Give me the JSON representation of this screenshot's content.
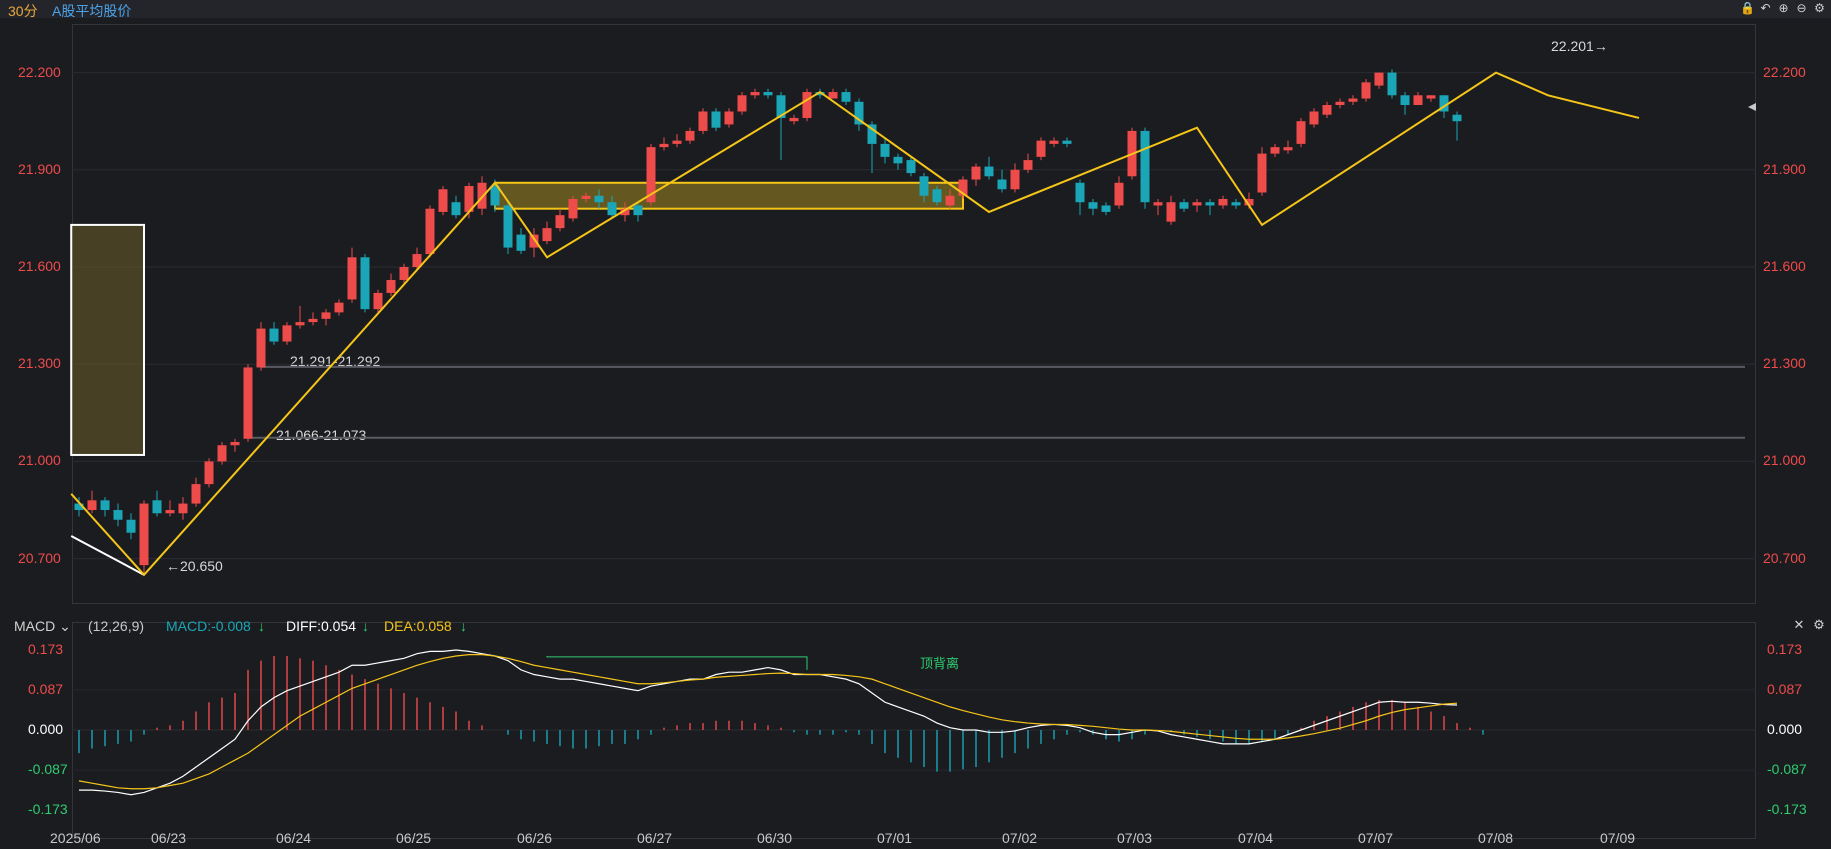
{
  "header": {
    "period": "30分",
    "title": "A股平均股价",
    "tools": [
      {
        "name": "lock-icon",
        "glyph": "🔒"
      },
      {
        "name": "undo-icon",
        "glyph": "↶"
      },
      {
        "name": "zoom-in-icon",
        "glyph": "⊕"
      },
      {
        "name": "zoom-out-icon",
        "glyph": "⊖"
      },
      {
        "name": "gear-icon",
        "glyph": "⚙"
      }
    ]
  },
  "main_axis": {
    "left_ticks": [
      "22.200",
      "21.900",
      "21.600",
      "21.300",
      "21.000",
      "20.700"
    ],
    "right_ticks": [
      "22.200",
      "21.900",
      "21.600",
      "21.300",
      "21.000",
      "20.700"
    ],
    "tick_color": "#ee4b4b"
  },
  "annotations": {
    "low": "←20.650",
    "high": "22.201→",
    "level1": "21.291-21.292",
    "level2": "21.066-21.073"
  },
  "macd": {
    "indicator": "MACD",
    "params": "(12,26,9)",
    "macd_label": "MACD:-0.008",
    "diff_label": "DIFF:0.054",
    "dea_label": "DEA:0.058",
    "divergence": "顶背离",
    "ticks": [
      "0.173",
      "0.087",
      "0.000",
      "-0.087",
      "-0.173"
    ],
    "tick_colors": [
      "#ee4b4b",
      "#ee4b4b",
      "#ffffff",
      "#2ecc71",
      "#2ecc71"
    ],
    "colors": {
      "up": "#ee4b4b",
      "down": "#1aa6b7",
      "diff": "#ffffff",
      "dea": "#f5c518",
      "macd_label": "#1aa6b7",
      "dea_label": "#f5c518"
    }
  },
  "x_labels": [
    "2025/06",
    "06/23",
    "06/24",
    "06/25",
    "06/26",
    "06/27",
    "06/30",
    "07/01",
    "07/02",
    "07/03",
    "07/04",
    "07/07",
    "07/08",
    "07/09"
  ],
  "colors": {
    "up": "#ee4b4b",
    "down": "#1aa6b7",
    "zigzag": "#f5c518",
    "background": "#1b1c20"
  },
  "chart_data": {
    "type": "candlestick",
    "ylim": [
      20.56,
      22.35
    ],
    "candles": [
      [
        20.87,
        20.85,
        20.89,
        20.83
      ],
      [
        20.85,
        20.88,
        20.91,
        20.84
      ],
      [
        20.88,
        20.85,
        20.89,
        20.83
      ],
      [
        20.85,
        20.82,
        20.87,
        20.8
      ],
      [
        20.82,
        20.78,
        20.84,
        20.76
      ],
      [
        20.68,
        20.87,
        20.88,
        20.65
      ],
      [
        20.88,
        20.84,
        20.91,
        20.83
      ],
      [
        20.84,
        20.85,
        20.88,
        20.83
      ],
      [
        20.84,
        20.87,
        20.89,
        20.82
      ],
      [
        20.87,
        20.93,
        20.95,
        20.86
      ],
      [
        20.93,
        21.0,
        21.01,
        20.92
      ],
      [
        21.0,
        21.05,
        21.06,
        20.99
      ],
      [
        21.05,
        21.06,
        21.07,
        21.03
      ],
      [
        21.07,
        21.29,
        21.3,
        21.06
      ],
      [
        21.29,
        21.41,
        21.43,
        21.28
      ],
      [
        21.41,
        21.37,
        21.43,
        21.36
      ],
      [
        21.37,
        21.42,
        21.43,
        21.36
      ],
      [
        21.42,
        21.43,
        21.48,
        21.41
      ],
      [
        21.43,
        21.44,
        21.46,
        21.42
      ],
      [
        21.44,
        21.46,
        21.47,
        21.42
      ],
      [
        21.46,
        21.49,
        21.5,
        21.45
      ],
      [
        21.5,
        21.63,
        21.66,
        21.49
      ],
      [
        21.63,
        21.47,
        21.64,
        21.46
      ],
      [
        21.47,
        21.52,
        21.53,
        21.46
      ],
      [
        21.52,
        21.56,
        21.58,
        21.51
      ],
      [
        21.56,
        21.6,
        21.61,
        21.55
      ],
      [
        21.6,
        21.64,
        21.66,
        21.59
      ],
      [
        21.64,
        21.78,
        21.79,
        21.63
      ],
      [
        21.77,
        21.84,
        21.85,
        21.76
      ],
      [
        21.8,
        21.76,
        21.82,
        21.75
      ],
      [
        21.77,
        21.85,
        21.86,
        21.75
      ],
      [
        21.78,
        21.86,
        21.88,
        21.76
      ],
      [
        21.85,
        21.79,
        21.87,
        21.77
      ],
      [
        21.79,
        21.66,
        21.8,
        21.64
      ],
      [
        21.7,
        21.65,
        21.72,
        21.64
      ],
      [
        21.66,
        21.7,
        21.72,
        21.63
      ],
      [
        21.68,
        21.72,
        21.74,
        21.67
      ],
      [
        21.72,
        21.76,
        21.78,
        21.71
      ],
      [
        21.75,
        21.81,
        21.82,
        21.74
      ],
      [
        21.81,
        21.82,
        21.83,
        21.8
      ],
      [
        21.82,
        21.8,
        21.84,
        21.78
      ],
      [
        21.8,
        21.76,
        21.82,
        21.75
      ],
      [
        21.76,
        21.78,
        21.8,
        21.74
      ],
      [
        21.79,
        21.76,
        21.8,
        21.74
      ],
      [
        21.8,
        21.97,
        21.98,
        21.79
      ],
      [
        21.97,
        21.98,
        22.0,
        21.96
      ],
      [
        21.98,
        21.99,
        22.01,
        21.97
      ],
      [
        21.99,
        22.02,
        22.03,
        21.98
      ],
      [
        22.02,
        22.08,
        22.09,
        22.01
      ],
      [
        22.08,
        22.03,
        22.09,
        22.02
      ],
      [
        22.04,
        22.08,
        22.09,
        22.03
      ],
      [
        22.08,
        22.13,
        22.14,
        22.07
      ],
      [
        22.13,
        22.14,
        22.15,
        22.12
      ],
      [
        22.14,
        22.13,
        22.15,
        22.12
      ],
      [
        22.13,
        22.06,
        22.14,
        21.93
      ],
      [
        22.05,
        22.06,
        22.07,
        22.04
      ],
      [
        22.06,
        22.14,
        22.15,
        22.05
      ],
      [
        22.14,
        22.13,
        22.15,
        22.12
      ],
      [
        22.12,
        22.14,
        22.15,
        22.12
      ],
      [
        22.14,
        22.11,
        22.15,
        22.1
      ],
      [
        22.11,
        22.04,
        22.12,
        22.02
      ],
      [
        22.04,
        21.98,
        22.05,
        21.89
      ],
      [
        21.98,
        21.94,
        22.0,
        21.92
      ],
      [
        21.94,
        21.92,
        21.95,
        21.9
      ],
      [
        21.93,
        21.89,
        21.94,
        21.88
      ],
      [
        21.88,
        21.82,
        21.89,
        21.8
      ],
      [
        21.84,
        21.8,
        21.85,
        21.79
      ],
      [
        21.79,
        21.82,
        21.84,
        21.78
      ],
      [
        21.82,
        21.87,
        21.88,
        21.81
      ],
      [
        21.87,
        21.91,
        21.92,
        21.85
      ],
      [
        21.91,
        21.88,
        21.94,
        21.87
      ],
      [
        21.87,
        21.84,
        21.9,
        21.83
      ],
      [
        21.84,
        21.9,
        21.92,
        21.83
      ],
      [
        21.9,
        21.93,
        21.95,
        21.89
      ],
      [
        21.94,
        21.99,
        22.0,
        21.93
      ],
      [
        21.98,
        21.99,
        22.0,
        21.97
      ],
      [
        21.99,
        21.98,
        22.0,
        21.97
      ],
      [
        21.86,
        21.8,
        21.87,
        21.76
      ],
      [
        21.8,
        21.78,
        21.81,
        21.76
      ],
      [
        21.79,
        21.77,
        21.8,
        21.76
      ],
      [
        21.79,
        21.86,
        21.88,
        21.78
      ],
      [
        21.88,
        22.02,
        22.03,
        21.87
      ],
      [
        22.02,
        21.8,
        22.03,
        21.78
      ],
      [
        21.79,
        21.8,
        21.81,
        21.76
      ],
      [
        21.74,
        21.8,
        21.82,
        21.73
      ],
      [
        21.8,
        21.78,
        21.81,
        21.77
      ],
      [
        21.79,
        21.8,
        21.81,
        21.77
      ],
      [
        21.8,
        21.79,
        21.81,
        21.76
      ],
      [
        21.79,
        21.81,
        21.82,
        21.78
      ],
      [
        21.8,
        21.79,
        21.81,
        21.78
      ],
      [
        21.79,
        21.81,
        21.83,
        21.78
      ],
      [
        21.83,
        21.95,
        21.97,
        21.82
      ],
      [
        21.95,
        21.97,
        21.98,
        21.94
      ],
      [
        21.96,
        21.97,
        21.99,
        21.95
      ],
      [
        21.98,
        22.05,
        22.06,
        21.97
      ],
      [
        22.04,
        22.08,
        22.09,
        22.03
      ],
      [
        22.07,
        22.1,
        22.11,
        22.06
      ],
      [
        22.1,
        22.11,
        22.12,
        22.09
      ],
      [
        22.11,
        22.12,
        22.13,
        22.1
      ],
      [
        22.12,
        22.17,
        22.18,
        22.11
      ],
      [
        22.16,
        22.2,
        22.2,
        22.15
      ],
      [
        22.2,
        22.13,
        22.21,
        22.12
      ],
      [
        22.13,
        22.1,
        22.14,
        22.07
      ],
      [
        22.1,
        22.13,
        22.14,
        22.1
      ],
      [
        22.12,
        22.13,
        22.13,
        22.11
      ],
      [
        22.13,
        22.08,
        22.13,
        22.06
      ],
      [
        22.07,
        22.05,
        22.08,
        21.99
      ]
    ],
    "zigzag": [
      [
        -0.6,
        20.9
      ],
      [
        5,
        20.65
      ],
      [
        32,
        21.86
      ],
      [
        36,
        21.63
      ],
      [
        57,
        22.14
      ],
      [
        70,
        21.77
      ],
      [
        86,
        22.03
      ],
      [
        91,
        21.73
      ],
      [
        109,
        22.2
      ],
      [
        113,
        22.13
      ],
      [
        120,
        22.06
      ]
    ],
    "support_line": [
      [
        -0.6,
        20.77
      ],
      [
        5,
        20.65
      ]
    ],
    "boxes": [
      {
        "i1": -0.6,
        "i2": 5,
        "top": 21.73,
        "bottom": 21.02
      },
      {
        "i1": 32,
        "i2": 68,
        "top": 21.86,
        "bottom": 21.78
      }
    ],
    "levels": [
      {
        "from": 14,
        "value": 21.292
      },
      {
        "from": 13,
        "value": 21.073
      }
    ],
    "macd_hist": [
      -0.05,
      -0.04,
      -0.035,
      -0.03,
      -0.025,
      -0.01,
      0.005,
      0.01,
      0.02,
      0.04,
      0.06,
      0.07,
      0.08,
      0.13,
      0.15,
      0.16,
      0.16,
      0.155,
      0.15,
      0.14,
      0.13,
      0.12,
      0.11,
      0.1,
      0.09,
      0.08,
      0.07,
      0.06,
      0.05,
      0.04,
      0.02,
      0.01,
      0.0,
      -0.01,
      -0.02,
      -0.025,
      -0.03,
      -0.035,
      -0.04,
      -0.04,
      -0.035,
      -0.03,
      -0.03,
      -0.02,
      -0.01,
      0.005,
      0.01,
      0.015,
      0.015,
      0.02,
      0.02,
      0.02,
      0.015,
      0.01,
      0.005,
      -0.005,
      -0.01,
      -0.01,
      -0.01,
      -0.005,
      -0.01,
      -0.03,
      -0.05,
      -0.06,
      -0.07,
      -0.08,
      -0.09,
      -0.09,
      -0.085,
      -0.08,
      -0.07,
      -0.06,
      -0.05,
      -0.04,
      -0.03,
      -0.02,
      -0.01,
      -0.005,
      -0.01,
      -0.02,
      -0.025,
      -0.02,
      -0.01,
      0.0,
      -0.005,
      -0.01,
      -0.015,
      -0.02,
      -0.025,
      -0.03,
      -0.03,
      -0.025,
      -0.02,
      -0.01,
      0.005,
      0.02,
      0.03,
      0.04,
      0.05,
      0.06,
      0.065,
      0.065,
      0.06,
      0.05,
      0.04,
      0.03,
      0.015,
      0.005,
      -0.01
    ],
    "diff": [
      -0.13,
      -0.13,
      -0.132,
      -0.135,
      -0.14,
      -0.135,
      -0.125,
      -0.115,
      -0.1,
      -0.08,
      -0.06,
      -0.04,
      -0.02,
      0.02,
      0.05,
      0.07,
      0.085,
      0.095,
      0.105,
      0.115,
      0.125,
      0.14,
      0.14,
      0.145,
      0.15,
      0.155,
      0.165,
      0.17,
      0.17,
      0.173,
      0.17,
      0.165,
      0.16,
      0.15,
      0.13,
      0.12,
      0.115,
      0.11,
      0.11,
      0.105,
      0.1,
      0.095,
      0.09,
      0.085,
      0.095,
      0.1,
      0.105,
      0.11,
      0.11,
      0.12,
      0.125,
      0.125,
      0.13,
      0.135,
      0.13,
      0.12,
      0.12,
      0.12,
      0.115,
      0.11,
      0.1,
      0.08,
      0.06,
      0.05,
      0.04,
      0.03,
      0.015,
      0.005,
      0.0,
      0.0,
      -0.005,
      -0.005,
      -0.002,
      0.005,
      0.01,
      0.012,
      0.01,
      0.005,
      -0.005,
      -0.01,
      -0.01,
      -0.005,
      0.0,
      -0.002,
      -0.01,
      -0.015,
      -0.02,
      -0.025,
      -0.03,
      -0.03,
      -0.03,
      -0.025,
      -0.02,
      -0.01,
      0.0,
      0.01,
      0.02,
      0.03,
      0.04,
      0.05,
      0.06,
      0.062,
      0.06,
      0.06,
      0.058,
      0.055,
      0.054
    ],
    "dea": [
      -0.11,
      -0.115,
      -0.12,
      -0.125,
      -0.127,
      -0.127,
      -0.125,
      -0.12,
      -0.115,
      -0.105,
      -0.095,
      -0.08,
      -0.065,
      -0.05,
      -0.03,
      -0.01,
      0.01,
      0.03,
      0.045,
      0.06,
      0.075,
      0.09,
      0.1,
      0.11,
      0.12,
      0.13,
      0.14,
      0.148,
      0.155,
      0.16,
      0.163,
      0.163,
      0.16,
      0.155,
      0.148,
      0.14,
      0.135,
      0.13,
      0.125,
      0.12,
      0.115,
      0.11,
      0.105,
      0.1,
      0.1,
      0.102,
      0.105,
      0.108,
      0.11,
      0.114,
      0.116,
      0.118,
      0.12,
      0.122,
      0.123,
      0.122,
      0.12,
      0.12,
      0.12,
      0.118,
      0.115,
      0.11,
      0.1,
      0.09,
      0.08,
      0.07,
      0.06,
      0.05,
      0.042,
      0.035,
      0.028,
      0.022,
      0.018,
      0.015,
      0.013,
      0.012,
      0.012,
      0.01,
      0.008,
      0.005,
      0.002,
      0.0,
      0.0,
      -0.001,
      -0.003,
      -0.006,
      -0.009,
      -0.012,
      -0.015,
      -0.018,
      -0.02,
      -0.02,
      -0.02,
      -0.017,
      -0.013,
      -0.008,
      -0.002,
      0.004,
      0.012,
      0.02,
      0.03,
      0.038,
      0.044,
      0.048,
      0.052,
      0.056,
      0.058
    ],
    "macd_ylim": [
      -0.173,
      0.173
    ]
  }
}
